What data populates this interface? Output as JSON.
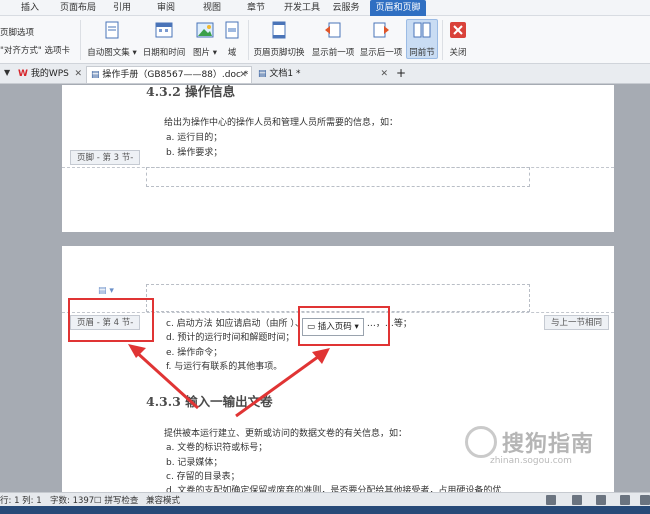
{
  "menu": {
    "tabs": [
      "插入",
      "页面布局",
      "引用",
      "审阅",
      "视图",
      "章节",
      "开发工具",
      "云服务",
      "页眉和页脚"
    ],
    "active_index": 8
  },
  "ribbon": {
    "left_line1": "页脚选项",
    "left_line2": "\"对齐方式\" 选项卡",
    "buttons": {
      "auto_text": "自动图文集",
      "datetime": "日期和时间",
      "picture": "图片",
      "field": "域",
      "switch": "页眉页脚切换",
      "prev": "显示前一项",
      "next": "显示后一项",
      "same_prev": "同前节",
      "close": "关闭"
    }
  },
  "doc_tabs": {
    "home": "我的WPS",
    "active": "操作手册（GB8567——88）.doc *",
    "other": "文档1 *",
    "add": "+"
  },
  "page1": {
    "heading": "4.3.2 操作信息",
    "para": "给出为操作中心的操作人员和管理人员所需要的信息，如：",
    "items": [
      "a.   运行目的；",
      "b.   操作要求；"
    ],
    "footer_tag": "页脚 - 第 3 节-"
  },
  "page2": {
    "header_tag": "页眉 - 第 4 节-",
    "same_as_prev": "与上一节相同",
    "insert_page_btn": "插入页码",
    "items": [
      "c.   启动方法 如应请启动（由所     ）、预定时间启动、…，…等；",
      "d.   预计的运行时间和解题时间；",
      "e.   操作命令；",
      "f.   与运行有联系的其他事项。"
    ],
    "heading": "4.3.3 输入一输出文卷",
    "para": "提供被本运行建立、更新或访问的数据文卷的有关信息，如：",
    "items2": [
      "a.   文卷的标识符或标号；",
      "b.   记录媒体；",
      "c.   存留的目录表；",
      "d.   文卷的支配如确定保留或废弃的准则，是否要分配给其他接受者，占用硬设备的优"
    ]
  },
  "status": {
    "row_col": "行: 1  列: 1",
    "word_count": "字数: 1397",
    "spell": "拼写检查",
    "compat": "兼容模式"
  },
  "watermark": {
    "text": "搜狗指南",
    "sub": "zhinan.sogou.com"
  },
  "colors": {
    "accent": "#2f6fc2",
    "annotation_red": "#e03434"
  }
}
